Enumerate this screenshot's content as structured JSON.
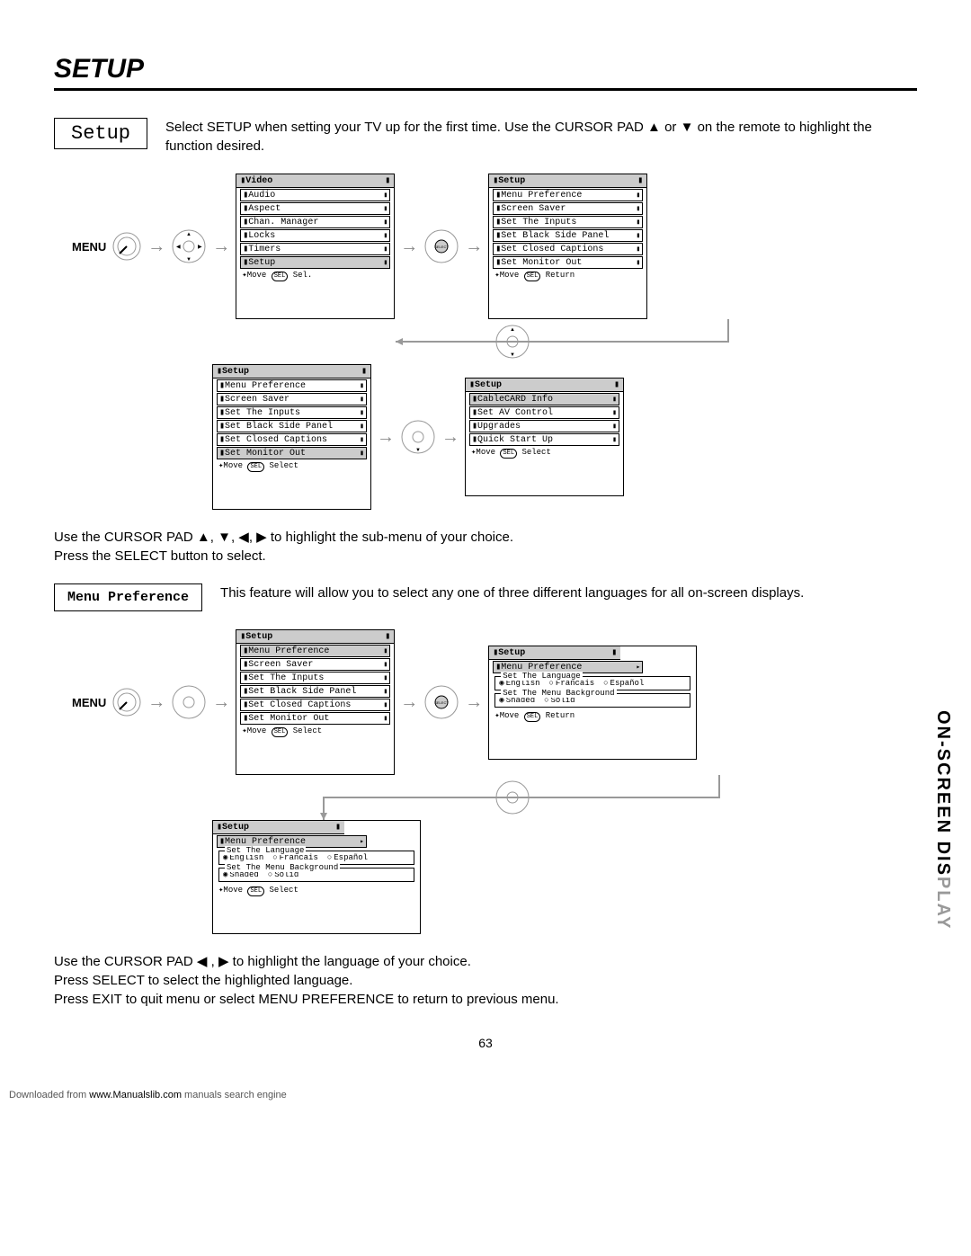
{
  "pageTitle": "SETUP",
  "sideTabDark": "ON-SCREEN DIS",
  "sideTabLight": "PLAY",
  "pageNumber": "63",
  "footer": {
    "pre": "Downloaded from ",
    "link": "www.Manualslib.com",
    "post": " manuals search engine"
  },
  "setup": {
    "boxLabel": "Setup",
    "desc": "Select SETUP when setting your TV up for the first time.  Use the CURSOR PAD ▲ or ▼ on the remote to highlight the function desired.",
    "menuLabel": "MENU",
    "mainMenu": {
      "header": "Video",
      "items": [
        "Audio",
        "Aspect",
        "Chan. Manager",
        "Locks",
        "Timers",
        "Setup"
      ],
      "selected": "Setup",
      "foot": "Move",
      "footBtn": "SEL",
      "footAct": "Sel."
    },
    "setupMenu1": {
      "header": "Setup",
      "items": [
        "Menu Preference",
        "Screen Saver",
        "Set The Inputs",
        "Set Black Side Panel",
        "Set Closed Captions",
        "Set Monitor Out"
      ],
      "selected": "",
      "foot": "Move",
      "footBtn": "SEL",
      "footAct": "Return"
    },
    "setupMenu2": {
      "header": "Setup",
      "items": [
        "Menu Preference",
        "Screen Saver",
        "Set The Inputs",
        "Set Black Side Panel",
        "Set Closed Captions",
        "Set Monitor Out"
      ],
      "selected": "Set Monitor Out",
      "foot": "Move",
      "footBtn": "SEL",
      "footAct": "Select"
    },
    "setupMenu3": {
      "header": "Setup",
      "items": [
        "CableCARD Info",
        "Set AV Control",
        "Upgrades",
        "Quick Start Up"
      ],
      "selected": "CableCARD Info",
      "foot": "Move",
      "footBtn": "SEL",
      "footAct": "Select"
    },
    "instructions": "Use the CURSOR PAD ▲, ▼, ◀, ▶ to highlight the sub-menu of your choice.\nPress the SELECT button to select."
  },
  "menuPref": {
    "boxLabel": "Menu Preference",
    "desc": "This feature will allow you to select any one of three different languages for all on-screen displays.",
    "menuLabel": "MENU",
    "menuA": {
      "header": "Setup",
      "items": [
        "Menu Preference",
        "Screen Saver",
        "Set The Inputs",
        "Set Black Side Panel",
        "Set Closed Captions",
        "Set Monitor Out"
      ],
      "selected": "Menu Preference",
      "foot": "Move",
      "footBtn": "SEL",
      "footAct": "Select"
    },
    "langMenu": {
      "header": "Setup",
      "sub": "Menu Preference",
      "langLegend": "Set The Language",
      "langs": [
        "English",
        "Francais",
        "Español"
      ],
      "langSel": "English",
      "bgLegend": "Set The Menu Background",
      "bgs": [
        "Shaded",
        "Solid"
      ],
      "bgSel": "Shaded",
      "foot": "Move",
      "footBtn": "SEL",
      "footAct": "Return"
    },
    "langMenu2": {
      "header": "Setup",
      "sub": "Menu Preference",
      "langLegend": "Set The Language",
      "langs": [
        "English",
        "Francais",
        "Español"
      ],
      "langSel": "English",
      "bgLegend": "Set The Menu Background",
      "bgs": [
        "Shaded",
        "Solid"
      ],
      "bgSel": "Shaded",
      "foot": "Move",
      "footBtn": "SEL",
      "footAct": "Select"
    },
    "instructions": "Use the CURSOR PAD ◀ , ▶ to highlight the language of your choice.\nPress SELECT to select the highlighted language.\nPress EXIT to quit menu or select MENU PREFERENCE to return to previous menu."
  }
}
